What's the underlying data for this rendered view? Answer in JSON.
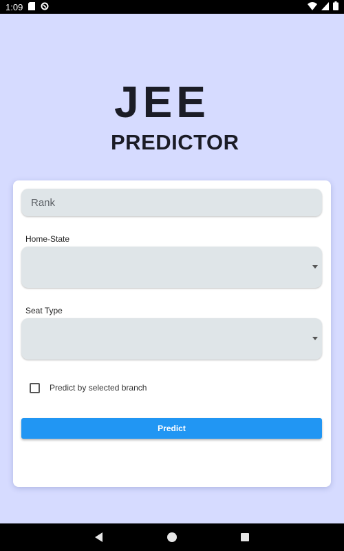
{
  "status_bar": {
    "time": "1:09",
    "icons": [
      "sd-card-icon",
      "data-saver-icon",
      "wifi-icon",
      "signal-icon",
      "battery-icon"
    ]
  },
  "title": {
    "line1": "JEE",
    "line2": "PREDICTOR"
  },
  "form": {
    "rank_placeholder": "Rank",
    "home_state_label": "Home-State",
    "home_state_value": "",
    "seat_type_label": "Seat Type",
    "seat_type_value": "",
    "checkbox_label": "Predict by selected branch",
    "checkbox_checked": false,
    "predict_button": "Predict"
  },
  "colors": {
    "background": "#d6dbff",
    "accent": "#2196f3",
    "field": "#dfe5e8"
  },
  "nav_bar": {
    "buttons": [
      "back-icon",
      "home-icon",
      "recents-icon"
    ]
  }
}
